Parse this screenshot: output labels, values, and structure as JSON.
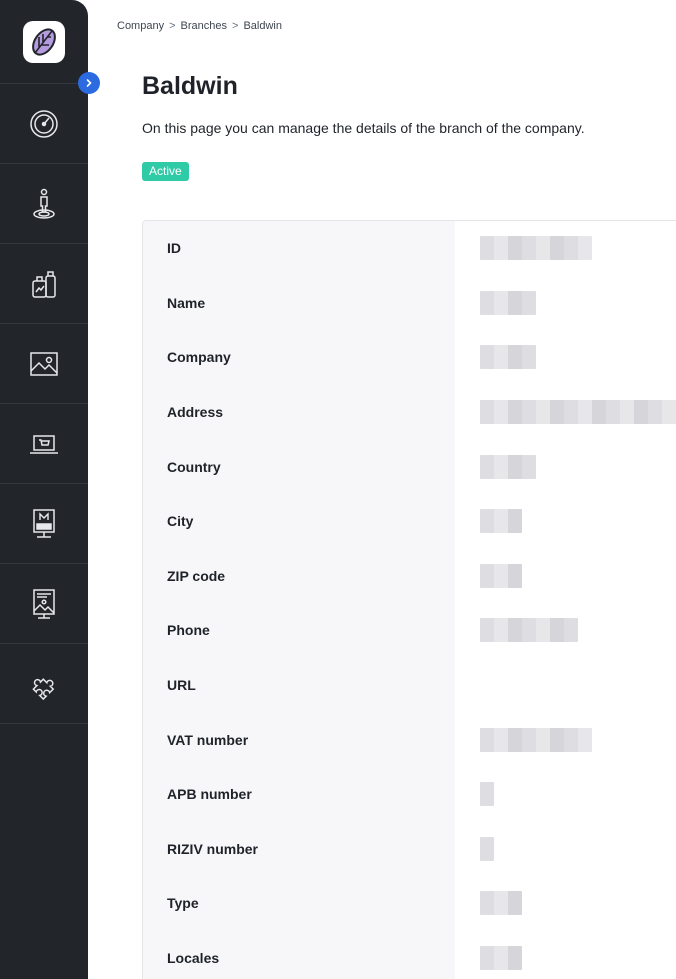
{
  "breadcrumb": [
    "Company",
    "Branches",
    "Baldwin"
  ],
  "breadcrumb_separator": ">",
  "page": {
    "title": "Baldwin",
    "description": "On this page you can manage the details of the branch of the company.",
    "status": "Active"
  },
  "colors": {
    "sidebar": "#22252a",
    "accent": "#2c6ae0",
    "status_active": "#2fcaa6",
    "label_column": "#f7f7f9"
  },
  "sidebar": {
    "logo_icon": "leaf-logo-icon",
    "items": [
      {
        "icon": "dashboard-gauge-icon"
      },
      {
        "icon": "person-location-icon"
      },
      {
        "icon": "products-bottles-icon"
      },
      {
        "icon": "image-gallery-icon"
      },
      {
        "icon": "laptop-cart-icon"
      },
      {
        "icon": "display-m-icon"
      },
      {
        "icon": "presentation-image-icon"
      },
      {
        "icon": "puzzle-piece-icon"
      }
    ]
  },
  "details": {
    "rows": [
      {
        "label": "ID",
        "value": ""
      },
      {
        "label": "Name",
        "value": ""
      },
      {
        "label": "Company",
        "value": ""
      },
      {
        "label": "Address",
        "value": ""
      },
      {
        "label": "Country",
        "value": ""
      },
      {
        "label": "City",
        "value": ""
      },
      {
        "label": "ZIP code",
        "value": ""
      },
      {
        "label": "Phone",
        "value": ""
      },
      {
        "label": "URL",
        "value": ""
      },
      {
        "label": "VAT number",
        "value": ""
      },
      {
        "label": "APB number",
        "value": ""
      },
      {
        "label": "RIZIV number",
        "value": ""
      },
      {
        "label": "Type",
        "value": ""
      },
      {
        "label": "Locales",
        "value": ""
      }
    ]
  }
}
